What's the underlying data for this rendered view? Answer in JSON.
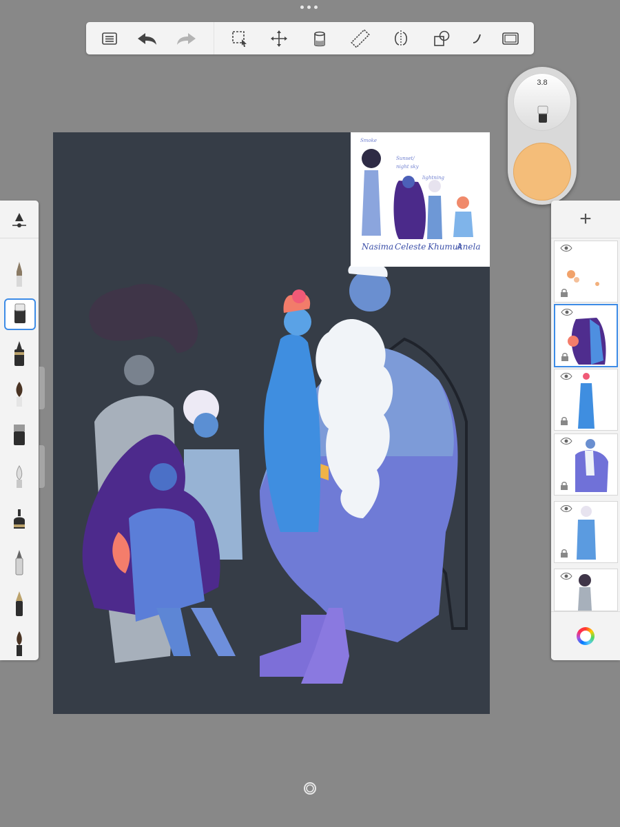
{
  "app": {
    "toolbar": {
      "icons": [
        "list-icon",
        "undo-icon",
        "redo-icon",
        "selection-icon",
        "transform-icon",
        "fill-icon",
        "ruler-icon",
        "symmetry-icon",
        "shapes-icon",
        "curve-icon",
        "fullscreen-icon"
      ]
    },
    "brush_puck": {
      "size_value": "3.8",
      "color": "#f4bd79"
    },
    "canvas": {
      "background": "#363d47",
      "reference_image": {
        "names": [
          "Nasima",
          "Celeste",
          "Khumuk",
          "Anela"
        ],
        "notes": [
          "Smoke",
          "Sunset/",
          "night sky",
          "lightning"
        ]
      }
    },
    "brush_panel": {
      "brushes": [
        "brush-pencil",
        "brush-marker",
        "brush-fineliner",
        "brush-paintbrush",
        "brush-airbrush",
        "brush-smudge",
        "brush-ink",
        "brush-technical-pen",
        "brush-fountain-pen",
        "brush-wet-brush"
      ],
      "active_index": 1
    },
    "layers": {
      "items": [
        "layer-sparks",
        "layer-anela",
        "layer-anela-tall",
        "layer-elder",
        "layer-khumuk",
        "layer-nasima"
      ],
      "active_index": 1
    },
    "colors": {
      "accent": "#3c8be6",
      "panel": "#f3f3f3",
      "background": "#888888"
    }
  }
}
